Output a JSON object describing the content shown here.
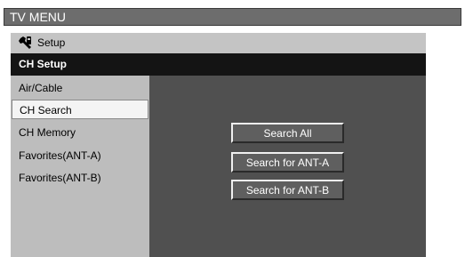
{
  "window": {
    "title": "TV MENU"
  },
  "menu": {
    "breadcrumb": "Setup",
    "section": "CH Setup"
  },
  "sidebar": {
    "items": [
      {
        "label": "Air/Cable"
      },
      {
        "label": "CH Search"
      },
      {
        "label": "CH Memory"
      },
      {
        "label": "Favorites(ANT-A)"
      },
      {
        "label": "Favorites(ANT-B)"
      }
    ],
    "selected": "CH Search"
  },
  "actions": [
    {
      "label": "Search All"
    },
    {
      "label": "Search for ANT-A"
    },
    {
      "label": "Search for ANT-B"
    }
  ],
  "colors": {
    "title_bar": "#6d6d6d",
    "panel": "#4e4e4e",
    "sidebar": "#bdbdbd",
    "selected_item": "#f4f4f4"
  },
  "icons": {
    "setup": "wrench-icon"
  }
}
